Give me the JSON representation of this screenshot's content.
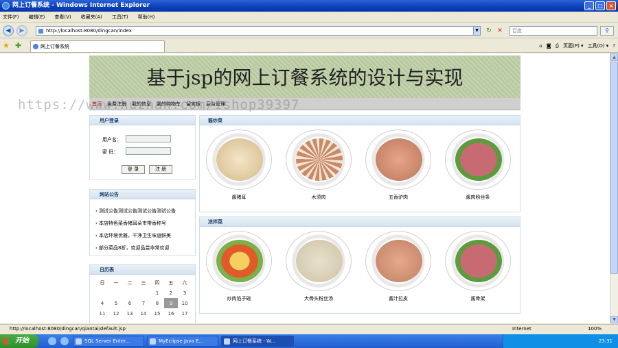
{
  "window": {
    "title": "网上订餐系统 - Windows Internet Explorer"
  },
  "menu": [
    "文件(F)",
    "编辑(E)",
    "查看(V)",
    "收藏夹(A)",
    "工具(T)",
    "帮助(H)"
  ],
  "address": {
    "url": "http://localhost:8080/dingcan/index",
    "search_placeholder": "百度"
  },
  "tab": {
    "label": "网上订餐系统"
  },
  "tools": [
    "页面(P) ▾",
    "工具(O) ▾"
  ],
  "page": {
    "banner": "基于jsp的网上订餐系统的设计与实现",
    "nav": [
      "首页",
      "免费注册",
      "我的信息",
      "我的购物车",
      "留言板",
      "后台管理"
    ],
    "watermark": "https://www.huzhan.com/ishop39397",
    "login": {
      "title": "用户登录",
      "user_label": "用户名：",
      "pass_label": "密  码：",
      "login_btn": "登 录",
      "register_btn": "注 册"
    },
    "notice": {
      "title": "网站公告",
      "items": [
        "测试公告测试公告测试公告测试公告",
        "本店特色菜香猪耳朵市带香称号",
        "本店环境优雅，干净卫生味道鲜美",
        "部分菜品8折，欢迎品尝非常欢迎"
      ]
    },
    "calendar": {
      "title": "日历表",
      "weekdays": [
        "日",
        "一",
        "二",
        "三",
        "四",
        "五",
        "六"
      ],
      "rows": [
        [
          "",
          "",
          "",
          "",
          "1",
          "2",
          "3"
        ],
        [
          "4",
          "5",
          "6",
          "7",
          "8",
          "9",
          "10"
        ],
        [
          "11",
          "12",
          "13",
          "14",
          "15",
          "16",
          "17"
        ]
      ],
      "selected": "9"
    },
    "sections": [
      {
        "title": "酱炒菜",
        "dishes": [
          "酱猪耳",
          "木须肉",
          "五香驴肉",
          "酱肉粉丝条"
        ]
      },
      {
        "title": "凉拌菜",
        "dishes": [
          "炒肉馅子碗",
          "大骨头粉丝汤",
          "酱汁拉皮",
          "酱骨架"
        ]
      }
    ]
  },
  "status": {
    "url": "http://localhost:8080/dingcan/qiantai/default.jsp",
    "zone": "Internet",
    "zoom": "100%"
  },
  "taskbar": {
    "start": "开始",
    "tasks": [
      "SQL Server Enter...",
      "MyEclipse Java E...",
      "网上订餐系统 - W..."
    ],
    "time": "23:31"
  }
}
